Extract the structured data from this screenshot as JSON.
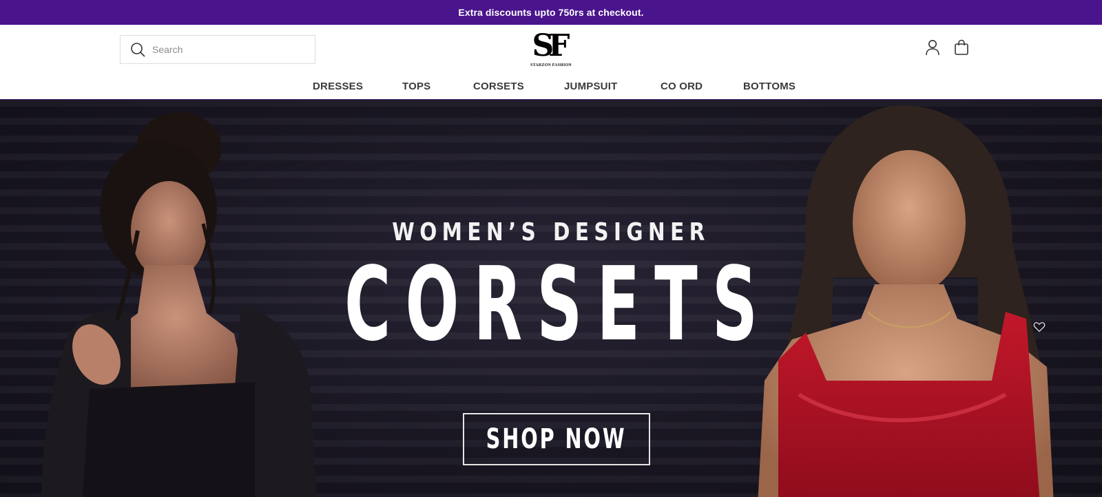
{
  "announcement": {
    "text": "Extra discounts upto 750rs at checkout."
  },
  "header": {
    "search": {
      "placeholder": "Search"
    },
    "logo": {
      "mark": "SF",
      "text": "STARZON FASHION"
    },
    "icons": {
      "account": "account-icon",
      "cart": "cart-icon",
      "search": "search-icon"
    }
  },
  "nav": {
    "items": [
      {
        "label": "DRESSES"
      },
      {
        "label": "TOPS"
      },
      {
        "label": "CORSETS"
      },
      {
        "label": "JUMPSUIT"
      },
      {
        "label": "CO ORD"
      },
      {
        "label": "BOTTOMS"
      }
    ]
  },
  "hero": {
    "subtitle": "WOMEN’S DESIGNER",
    "title": "CORSETS",
    "cta": "SHOP NOW"
  },
  "colors": {
    "announcement_bg": "#4a148c",
    "hero_bg": "#1a1724",
    "text_dark": "#3a3a3a"
  }
}
